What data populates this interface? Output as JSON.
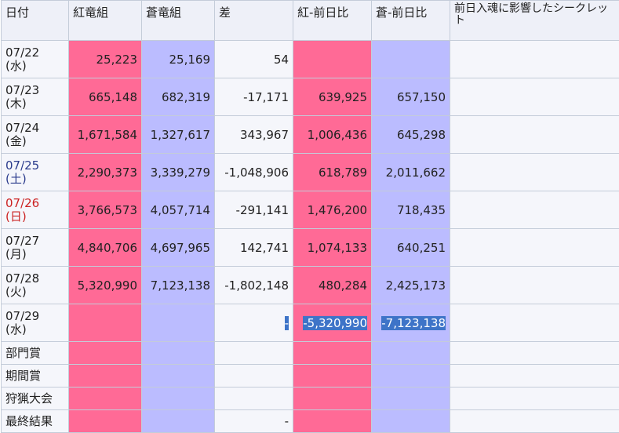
{
  "headers": [
    "日付",
    "紅竜組",
    "蒼竜組",
    "差",
    "紅-前日比",
    "蒼-前日比",
    "前日入魂に影響したシークレット"
  ],
  "days": [
    {
      "date": "07/22",
      "weekday": "(水)",
      "red": "25,223",
      "blue": "25,169",
      "diff": "54",
      "red_change": "",
      "blue_change": "",
      "dayclass": ""
    },
    {
      "date": "07/23",
      "weekday": "(木)",
      "red": "665,148",
      "blue": "682,319",
      "diff": "-17,171",
      "red_change": "639,925",
      "blue_change": "657,150",
      "dayclass": ""
    },
    {
      "date": "07/24",
      "weekday": "(金)",
      "red": "1,671,584",
      "blue": "1,327,617",
      "diff": "343,967",
      "red_change": "1,006,436",
      "blue_change": "645,298",
      "dayclass": ""
    },
    {
      "date": "07/25",
      "weekday": "(土)",
      "red": "2,290,373",
      "blue": "3,339,279",
      "diff": "-1,048,906",
      "red_change": "618,789",
      "blue_change": "2,011,662",
      "dayclass": "sat"
    },
    {
      "date": "07/26",
      "weekday": "(日)",
      "red": "3,766,573",
      "blue": "4,057,714",
      "diff": "-291,141",
      "red_change": "1,476,200",
      "blue_change": "718,435",
      "dayclass": "sun"
    },
    {
      "date": "07/27",
      "weekday": "(月)",
      "red": "4,840,706",
      "blue": "4,697,965",
      "diff": "142,741",
      "red_change": "1,074,133",
      "blue_change": "640,251",
      "dayclass": ""
    },
    {
      "date": "07/28",
      "weekday": "(火)",
      "red": "5,320,990",
      "blue": "7,123,138",
      "diff": "-1,802,148",
      "red_change": "480,284",
      "blue_change": "2,425,173",
      "dayclass": ""
    },
    {
      "date": "07/29",
      "weekday": "(水)",
      "red": "",
      "blue": "",
      "diff": "-",
      "red_change": "-5,320,990",
      "blue_change": "-7,123,138",
      "dayclass": ""
    }
  ],
  "footer_rows": [
    {
      "label": "部門賞",
      "diff": ""
    },
    {
      "label": "期間賞",
      "diff": ""
    },
    {
      "label": "狩猟大会",
      "diff": ""
    },
    {
      "label": "最終結果",
      "diff": "-"
    }
  ],
  "colors": {
    "red_team": "#ff6a96",
    "blue_team": "#bbbcff",
    "header_bg": "#eef0f8",
    "cell_bg": "#f5f6fb",
    "selection": "#3e74c8",
    "saturday": "#2a3b8c",
    "sunday": "#cc2222"
  }
}
